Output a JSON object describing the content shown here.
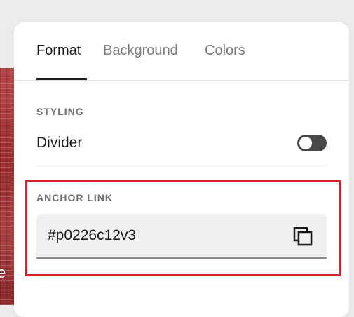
{
  "tabs": [
    {
      "label": "Format",
      "active": true
    },
    {
      "label": "Background",
      "active": false
    },
    {
      "label": "Colors",
      "active": false
    }
  ],
  "styling": {
    "section_label": "STYLING",
    "divider": {
      "label": "Divider",
      "enabled": false
    }
  },
  "anchor": {
    "section_label": "ANCHOR LINK",
    "value": "#p0226c12v3",
    "copy_icon": "copy-icon"
  },
  "backdrop": {
    "partial_text": "e"
  },
  "colors": {
    "highlight": "#dd1f26",
    "text": "#1a1a1a",
    "muted": "#7a7a7a",
    "toggle_off": "#4a4a4a",
    "field_bg": "#f0f0f0"
  }
}
